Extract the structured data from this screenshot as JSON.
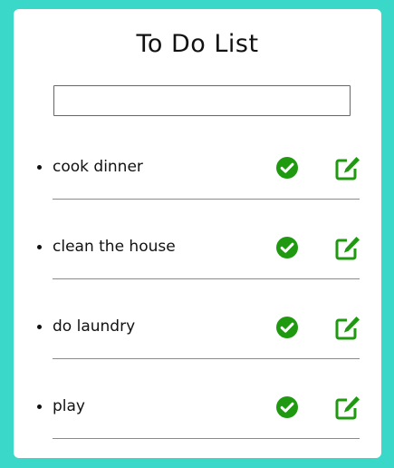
{
  "header": {
    "title": "To Do List"
  },
  "new_task": {
    "value": "",
    "placeholder": ""
  },
  "tasks": [
    {
      "label": "cook dinner",
      "done_icon": "check-circle-icon",
      "edit_icon": "edit-icon"
    },
    {
      "label": "clean the house",
      "done_icon": "check-circle-icon",
      "edit_icon": "edit-icon"
    },
    {
      "label": "do laundry",
      "done_icon": "check-circle-icon",
      "edit_icon": "edit-icon"
    },
    {
      "label": "play",
      "done_icon": "check-circle-icon",
      "edit_icon": "edit-icon"
    }
  ],
  "colors": {
    "background": "#3ad8c8",
    "card": "#ffffff",
    "icon_green": "#1f9a10",
    "divider": "#8a8a8a"
  }
}
